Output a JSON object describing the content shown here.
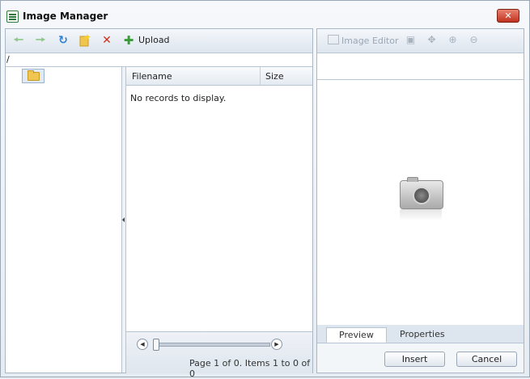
{
  "window": {
    "title": "Image Manager",
    "close_glyph": "✕"
  },
  "toolbar": {
    "back_icon": "arrow-left-icon",
    "forward_icon": "arrow-right-icon",
    "refresh_icon": "refresh-icon",
    "new_folder_icon": "new-folder-icon",
    "delete_icon": "delete-icon",
    "upload_label": "Upload"
  },
  "path": "/",
  "grid": {
    "columns": [
      "Filename",
      "Size"
    ],
    "empty_message": "No records to display.",
    "pager_text": "Page 1 of 0. Items 1 to 0 of 0"
  },
  "preview_toolbar": {
    "image_editor_label": "Image Editor"
  },
  "tabs": [
    "Preview",
    "Properties"
  ],
  "actions": {
    "insert_label": "Insert",
    "cancel_label": "Cancel"
  },
  "colors": {
    "accent_green": "#3b9a3a",
    "delete_red": "#d22f1e",
    "refresh_blue": "#2f7fcf"
  }
}
